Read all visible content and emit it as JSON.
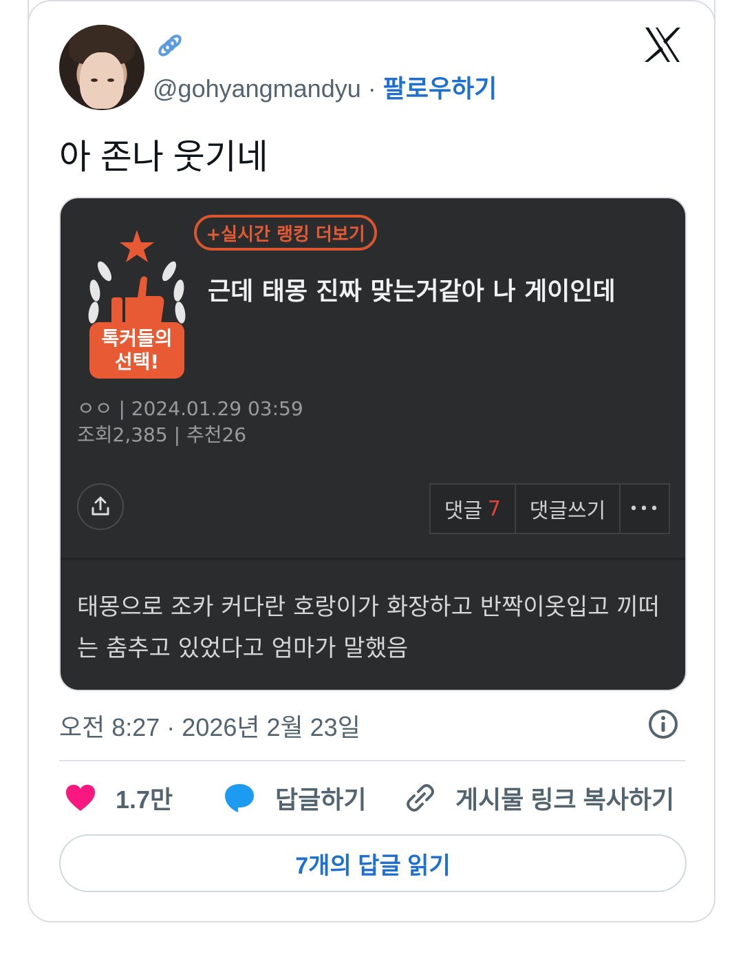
{
  "user": {
    "display_name_icon": "link-emoji-icon",
    "handle": "@gohyangmandyu",
    "separator": " · ",
    "follow_label": "팔로우하기"
  },
  "tweet": {
    "text": "아 존나 웃기네",
    "timestamp": "오전 8:27 · 2026년 2월 23일"
  },
  "embedded_post": {
    "rank_button": "+실시간 랭킹 더보기",
    "badge_line1": "톡커들의",
    "badge_line2": "선택!",
    "title": "근데 태몽 진짜 맞는거같아 나 게이인데",
    "author": "ㅇㅇ",
    "date": "| 2024.01.29 03:59",
    "views_label": "조회",
    "views": "2,385",
    "recommend_label": "| 추천",
    "recommend": "26",
    "comments_label": "댓글",
    "comments_count": "7",
    "write_comment_label": "댓글쓰기",
    "more_label": "•••",
    "body": "태몽으로 조카 커다란 호랑이가 화장하고 반짝이옷입고 끼떠는 춤추고 있었다고 엄마가 말했음"
  },
  "actions": {
    "like_count": "1.7만",
    "reply_label": "답글하기",
    "copy_link_label": "게시물 링크 복사하기",
    "read_replies_label": "7개의 답글 읽기"
  },
  "colors": {
    "accent_blue": "#1d6fd0",
    "heart_pink": "#f91880",
    "reply_blue": "#1d9bf0",
    "brand_orange": "#e85a33"
  }
}
